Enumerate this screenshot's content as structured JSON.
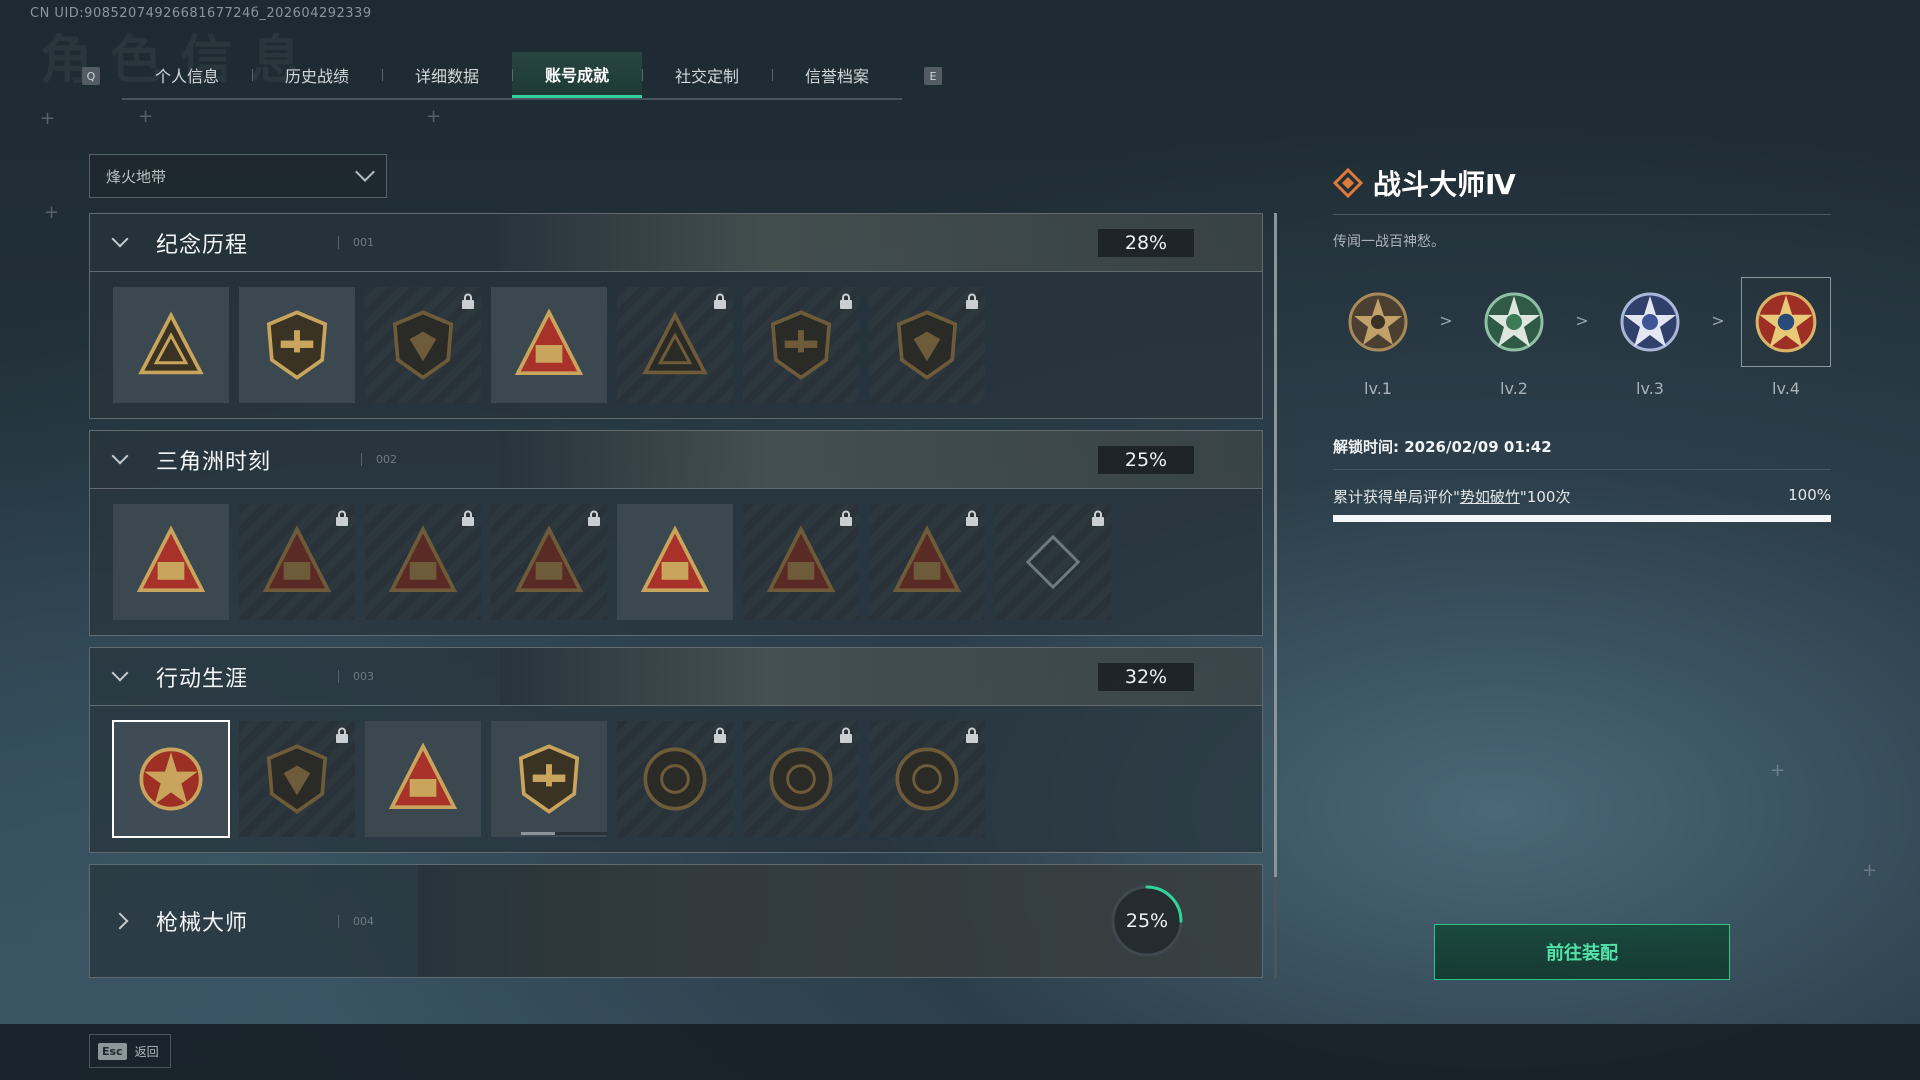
{
  "uid_text": "CN UID:9085207492668167724б_202604292339",
  "watermark": "角色信息",
  "tabbar": {
    "left_key": "Q",
    "right_key": "E",
    "tabs": [
      "个人信息",
      "历史战绩",
      "详细数据",
      "账号成就",
      "社交定制",
      "信誉档案"
    ],
    "active_index": 3
  },
  "filter": {
    "selected": "烽火地带"
  },
  "categories": [
    {
      "title": "纪念历程",
      "code": "001",
      "percent": "28%",
      "expanded": true,
      "badges": [
        {
          "icon": "triangle-emblem-icon",
          "locked": false
        },
        {
          "icon": "helicopter-shield-icon",
          "locked": false
        },
        {
          "icon": "dark-shield-icon",
          "locked": true
        },
        {
          "icon": "sector-58-triangle-icon",
          "locked": false
        },
        {
          "icon": "sector-58-wings-icon",
          "locked": true
        },
        {
          "icon": "hooded-operator-icon",
          "locked": true
        },
        {
          "icon": "skull-operator-icon",
          "locked": true
        }
      ]
    },
    {
      "title": "三角洲时刻",
      "code": "002",
      "percent": "25%",
      "expanded": true,
      "badges": [
        {
          "icon": "usb-triangle-icon",
          "locked": false
        },
        {
          "icon": "keycard-triangle-icon",
          "locked": true
        },
        {
          "icon": "kneeling-soldier-icon",
          "locked": true
        },
        {
          "icon": "laurel-triangle-icon",
          "locked": true
        },
        {
          "icon": "squad-triangle-icon",
          "locked": false
        },
        {
          "icon": "lion-crest-icon",
          "locked": true
        },
        {
          "icon": "eagle-triangle-icon",
          "locked": true
        },
        {
          "icon": "hidden-diamond-icon",
          "locked": true
        }
      ]
    },
    {
      "title": "行动生涯",
      "code": "003",
      "percent": "32%",
      "expanded": true,
      "badges": [
        {
          "icon": "star-medal-icon",
          "locked": false,
          "selected": true
        },
        {
          "icon": "chevron-shield-icon",
          "locked": true
        },
        {
          "icon": "winged-shield-icon",
          "locked": false
        },
        {
          "icon": "gem-shield-icon",
          "locked": false,
          "progress": true
        },
        {
          "icon": "helmet-coin-icon",
          "locked": true
        },
        {
          "icon": "skull-coin-icon",
          "locked": true
        },
        {
          "icon": "eye-coin-icon",
          "locked": true
        }
      ]
    },
    {
      "title": "枪械大师",
      "code": "004",
      "percent": "25%",
      "expanded": false,
      "ring_value": 0.25
    }
  ],
  "detail": {
    "title": "战斗大师Ⅳ",
    "description": "传闻一战百神愁。",
    "levels": [
      "lv.1",
      "lv.2",
      "lv.3",
      "lv.4"
    ],
    "current_level_index": 3,
    "separator": ">",
    "unlock_label": "解锁时间: 2026/02/09 01:42",
    "condition_prefix": "累计获得单局评价\"",
    "condition_highlight": "势如破竹",
    "condition_suffix": "\"100次",
    "condition_percent": "100%",
    "condition_progress": 1.0
  },
  "equip_label": "前往装配",
  "footer": {
    "esc_key": "Esc",
    "esc_label": "返回"
  },
  "colors": {
    "accent": "#33d29a",
    "gold": "#c9a45c",
    "red": "#b33a2a"
  }
}
